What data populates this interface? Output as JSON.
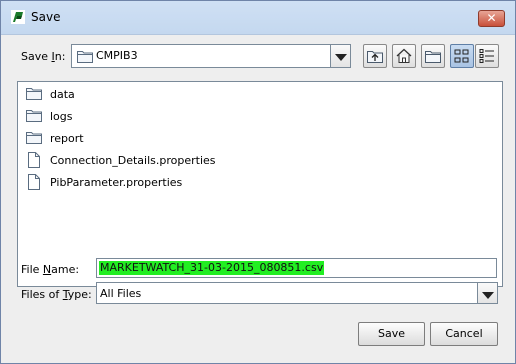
{
  "window": {
    "title": "Save",
    "close_label": "✕"
  },
  "save_in": {
    "label_mnemonic": "I",
    "label_pre": "Save ",
    "label_post": "n:",
    "current_folder": "CMPIB3"
  },
  "toolbar": {
    "icons": [
      "up-one-level-icon",
      "home-icon",
      "new-folder-icon",
      "list-view-icon",
      "details-view-icon"
    ]
  },
  "files": [
    {
      "name": "data",
      "type": "folder"
    },
    {
      "name": "logs",
      "type": "folder"
    },
    {
      "name": "report",
      "type": "folder"
    },
    {
      "name": "Connection_Details.properties",
      "type": "file"
    },
    {
      "name": "PibParameter.properties",
      "type": "file"
    }
  ],
  "file_name": {
    "label_pre": "File ",
    "label_mnemonic": "N",
    "label_post": "ame:",
    "value": "MARKETWATCH_31-03-2015_080851.csv"
  },
  "files_of_type": {
    "label_pre": "Files of ",
    "label_mnemonic": "T",
    "label_post": "ype:",
    "value": "All Files"
  },
  "buttons": {
    "save": "Save",
    "cancel": "Cancel"
  }
}
